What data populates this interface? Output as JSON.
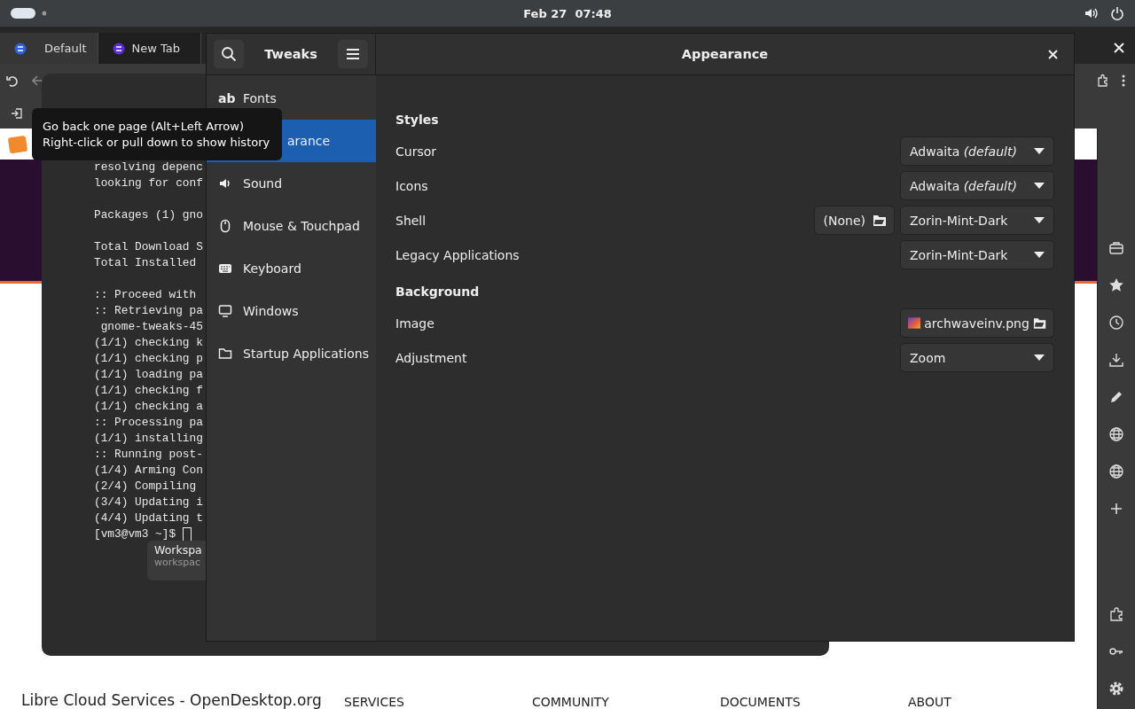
{
  "top_bar": {
    "clock": "Feb 27  07:48"
  },
  "browser": {
    "tabs": [
      {
        "label": "Default",
        "selected": true
      },
      {
        "label": "New Tab",
        "selected": false
      }
    ],
    "footer": {
      "site": "Libre Cloud Services - OpenDesktop.org",
      "links": [
        "SERVICES",
        "COMMUNITY",
        "DOCUMENTS",
        "ABOUT"
      ]
    }
  },
  "terminal": {
    "blocks": [
      [
        "resolving depenc",
        "looking for conf"
      ],
      [
        "Packages (1) gno"
      ],
      [
        "Total Download S",
        "Total Installed"
      ],
      [
        ":: Proceed with",
        ":: Retrieving pa",
        " gnome-tweaks-45",
        "(1/1) checking k",
        "(1/1) checking p",
        "(1/1) loading pa",
        "(1/1) checking f",
        "(1/1) checking a",
        ":: Processing pa",
        "(1/1) installing",
        ":: Running post-",
        "(1/4) Arming Con",
        "(2/4) Compiling",
        "(3/4) Updating i",
        "(4/4) Updating t",
        "[vm3@vm3 ~]$"
      ]
    ],
    "workspace_popup": {
      "title": "Workspa",
      "subtitle": "workspac"
    }
  },
  "tweaks": {
    "title": "Tweaks",
    "page_title": "Appearance",
    "sidebar": [
      {
        "label": "Fonts",
        "kind": "item",
        "glyph": "ab",
        "selected": false
      },
      {
        "label": "arance",
        "kind": "covered",
        "selected": true
      },
      {
        "label": "Sound",
        "kind": "item",
        "selected": false
      },
      {
        "label": "Mouse & Touchpad",
        "kind": "item",
        "selected": false
      },
      {
        "label": "Keyboard",
        "kind": "item",
        "selected": false
      },
      {
        "label": "Windows",
        "kind": "item",
        "selected": false
      },
      {
        "label": "Startup Applications",
        "kind": "item",
        "selected": false
      }
    ],
    "sections": [
      {
        "title": "Styles",
        "rows": [
          {
            "label": "Cursor",
            "kind": "dropdown",
            "value": "Adwaita *(default)*"
          },
          {
            "label": "Icons",
            "kind": "dropdown",
            "value": "Adwaita *(default)*"
          },
          {
            "label": "Shell",
            "kind": "dropdown",
            "value": "Zorin-Mint-Dark",
            "button": "(None)"
          },
          {
            "label": "Legacy Applications",
            "kind": "dropdown",
            "value": "Zorin-Mint-Dark"
          }
        ]
      },
      {
        "title": "Background",
        "rows": [
          {
            "label": "Image",
            "kind": "file",
            "value": "archwaveinv.png"
          },
          {
            "label": "Adjustment",
            "kind": "dropdown",
            "value": "Zoom"
          }
        ]
      }
    ]
  },
  "tooltip": {
    "lines": [
      "Go back one page (Alt+Left Arrow)",
      "Right-click or pull down to show history"
    ]
  }
}
